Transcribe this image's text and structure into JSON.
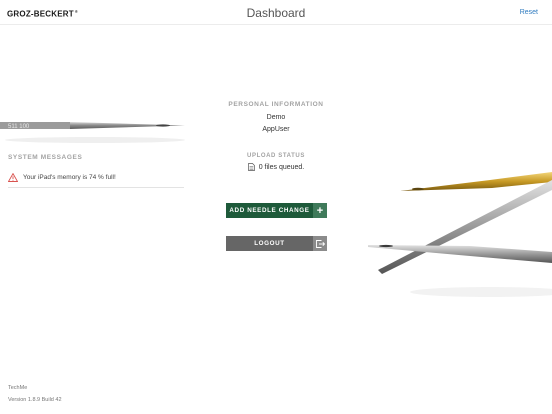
{
  "header": {
    "logo_text": "GROZ-BECKERT",
    "logo_mark": "®",
    "title": "Dashboard",
    "reset_label": "Reset"
  },
  "system_messages": {
    "heading": "SYSTEM MESSAGES",
    "items": [
      {
        "icon": "warning-triangle-icon",
        "text": "Your iPad's memory is 74 % full!"
      }
    ]
  },
  "personal_information": {
    "heading": "PERSONAL INFORMATION",
    "line1": "Demo",
    "line2": "AppUser"
  },
  "upload_status": {
    "heading": "UPLOAD STATUS",
    "icon": "document-icon",
    "text": "0 files queued."
  },
  "buttons": {
    "add_needle_change": {
      "label": "ADD NEEDLE CHANGE",
      "icon": "plus-icon"
    },
    "logout": {
      "label": "LOGOUT",
      "icon": "exit-icon"
    }
  },
  "footer": {
    "app_name": "TechMe",
    "version": "Version 1.8.9 Build 42"
  },
  "colors": {
    "accent_green": "#1e5a3a",
    "logout_gray": "#666666",
    "link_blue": "#2f7bbf",
    "warning_red": "#d9534f"
  }
}
